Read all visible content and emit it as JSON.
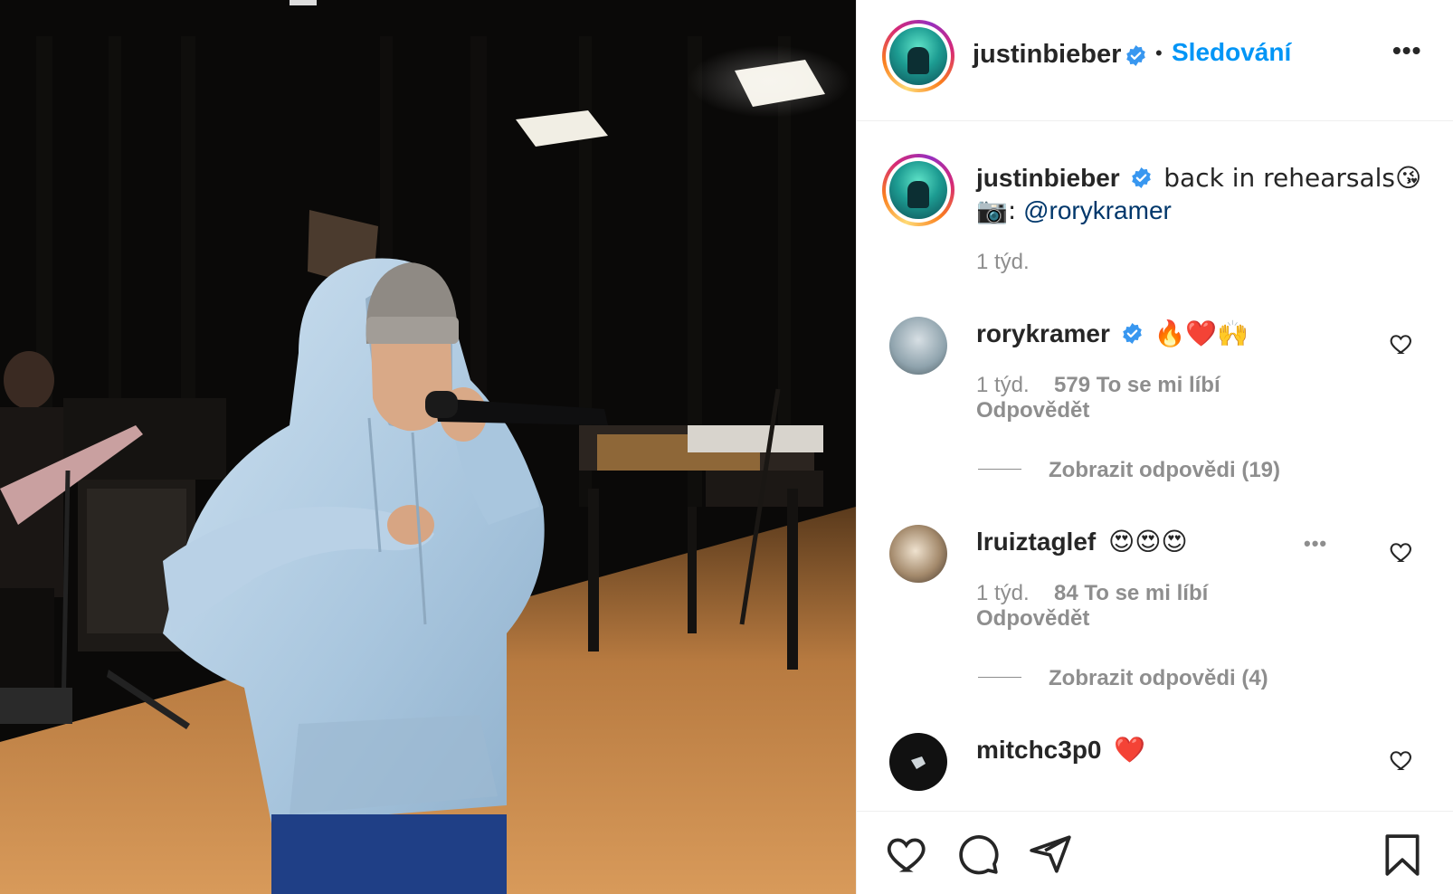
{
  "photo": {
    "description_alt": ""
  },
  "header": {
    "username": "justinbieber",
    "separator": "•",
    "follow_label": "Sledování",
    "more_icon": "more-horizontal-icon"
  },
  "caption": {
    "username": "justinbieber",
    "text": "back in rehearsals😘",
    "camera_emoji": "📷:",
    "mention": "@rorykramer",
    "time": "1 týd."
  },
  "comments": [
    {
      "username": "rorykramer",
      "verified": true,
      "text": "🔥❤️🙌",
      "time": "1 týd.",
      "likes": "579 To se mi líbí",
      "reply_label": "Odpovědět",
      "view_replies": "Zobrazit odpovědi (19)"
    },
    {
      "username": "lruiztaglef",
      "verified": false,
      "text": "😍😍😍",
      "time": "1 týd.",
      "likes": "84 To se mi líbí",
      "reply_label": "Odpovědět",
      "view_replies": "Zobrazit odpovědi (4)"
    },
    {
      "username": "mitchc3p0",
      "verified": false,
      "text": "❤️"
    }
  ],
  "actions": {
    "like_icon": "heart-icon",
    "comment_icon": "comment-icon",
    "share_icon": "share-icon",
    "save_icon": "bookmark-icon"
  },
  "colors": {
    "follow_blue": "#0095f6",
    "verified_blue": "#3897f0",
    "muted_text": "#8e8e8e",
    "mention_blue": "#00376b"
  }
}
